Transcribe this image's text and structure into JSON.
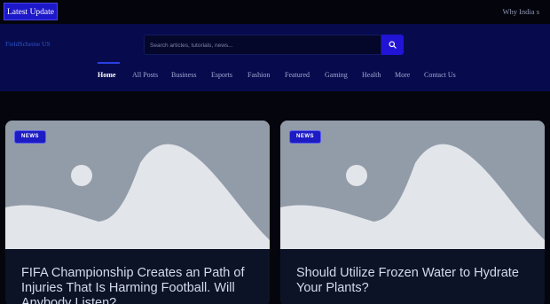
{
  "topbar": {
    "latest_label": "Latest Update",
    "ticker_text": "Why India s"
  },
  "header": {
    "site_name": "FieldScheme US",
    "search_placeholder": "Search articles, tutorials, news..."
  },
  "nav": {
    "items": [
      "Home",
      "All Posts",
      "Business",
      "Esports",
      "Fashion",
      "Featured",
      "Gaming",
      "Health",
      "More",
      "Contact Us"
    ],
    "active": "Home"
  },
  "cards": [
    {
      "tag": "NEWS",
      "title": "FIFA Championship Creates an Path of Injuries That Is Harming Football. Will Anybody Listen?"
    },
    {
      "tag": "NEWS",
      "title": "Should Utilize Frozen Water to Hydrate Your Plants?"
    }
  ],
  "colors": {
    "accent": "#1d18c9",
    "header_bg": "#070b4e",
    "page_bg": "#05060d",
    "card_bg": "#0d1327",
    "placeholder_image": "#929ba8"
  },
  "icons": {
    "search": "search-icon",
    "image_placeholder": "image-placeholder-icon"
  }
}
